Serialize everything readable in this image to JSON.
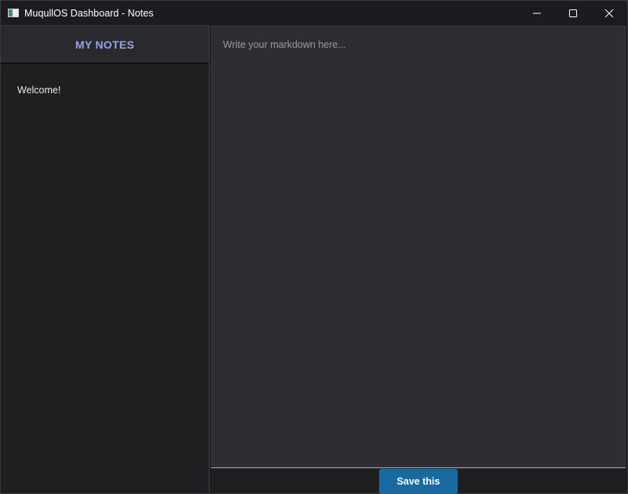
{
  "window": {
    "title": "MuqullOS Dashboard - Notes",
    "controls": {
      "minimize": "minimize-icon",
      "maximize": "maximize-icon",
      "close": "close-icon"
    }
  },
  "sidebar": {
    "title": "MY NOTES",
    "notes": [
      {
        "label": "Welcome!"
      }
    ]
  },
  "editor": {
    "value": "",
    "placeholder": "Write your markdown here..."
  },
  "footer": {
    "save_label": "Save this"
  },
  "colors": {
    "accent": "#1a6aa2",
    "sidebar_title": "#8ca8f0",
    "background": "#1f1e21",
    "editor_background": "#2e2d33"
  }
}
